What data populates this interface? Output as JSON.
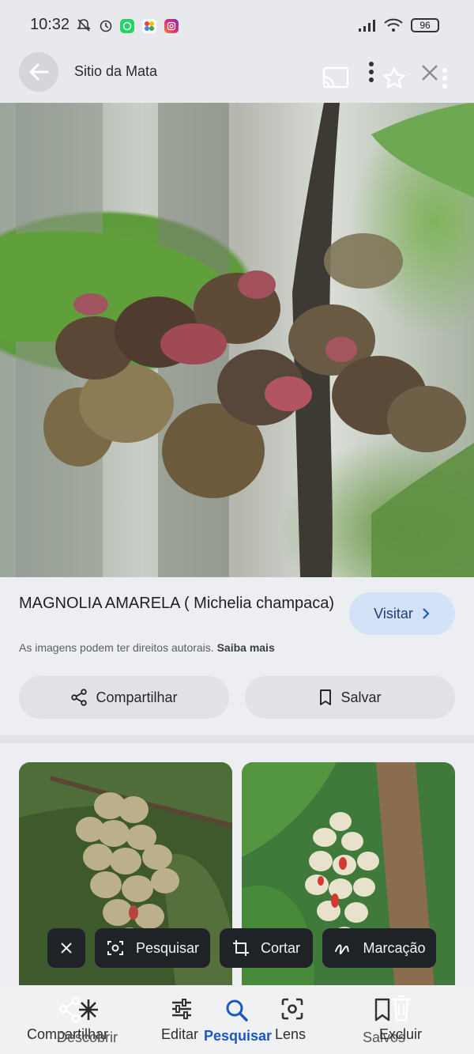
{
  "status_bar": {
    "time": "10:32",
    "battery": "96",
    "icons": [
      "mute-icon",
      "alarm-icon",
      "whatsapp-icon",
      "photos-icon",
      "instagram-icon",
      "signal-icon",
      "wifi-icon",
      "battery-icon"
    ]
  },
  "top_bar": {
    "site_name": "Sitio da Mata",
    "icons": [
      "back-arrow-icon",
      "cast-icon",
      "more-vertical-icon",
      "star-icon",
      "close-icon",
      "more-vertical-icon"
    ]
  },
  "result": {
    "title": "MAGNOLIA AMARELA ( Michelia champaca)",
    "visit_label": "Visitar",
    "copyright_text": "As imagens podem ter direitos autorais.",
    "learn_more": "Saiba mais",
    "share_label": "Compartilhar",
    "save_label": "Salvar"
  },
  "float_toolbar": {
    "search_label": "Pesquisar",
    "crop_label": "Cortar",
    "markup_label": "Marcação"
  },
  "bottom_nav": {
    "overlap_a_1": "Compartilhar",
    "overlap_a_2": "Descobrir",
    "edit_label": "Editar",
    "search_label": "Pesquisar",
    "lens_label": "Lens",
    "overlap_b_1": "Salvos",
    "overlap_b_2": "Excluir"
  },
  "colors": {
    "accent": "#1a56c4",
    "visit_bg": "#d3e2f7",
    "toolbar_bg": "#1f2327"
  }
}
